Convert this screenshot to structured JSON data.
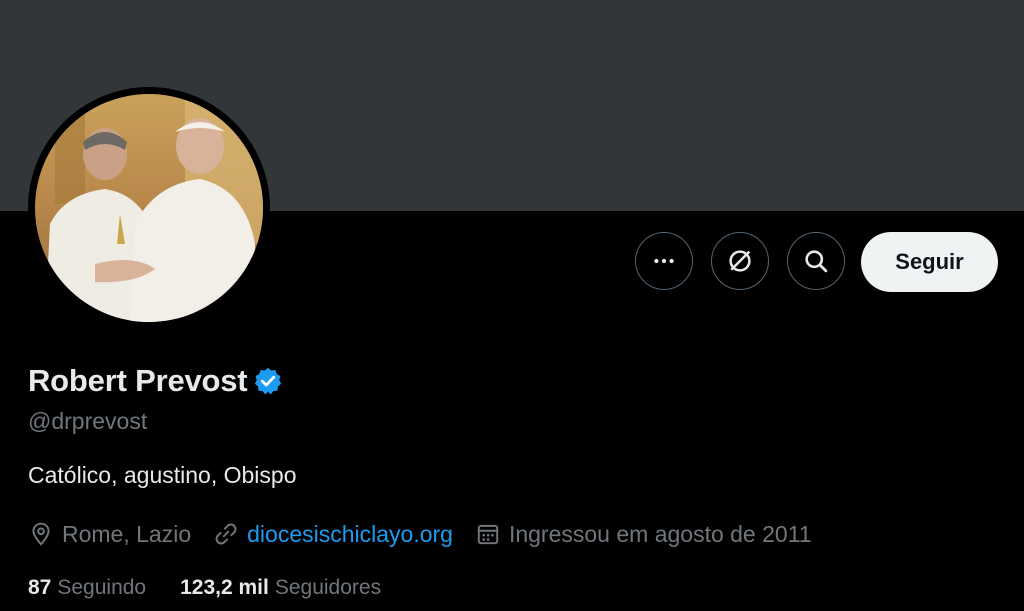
{
  "profile": {
    "display_name": "Robert Prevost",
    "handle": "@drprevost",
    "bio": "Católico, agustino, Obispo",
    "verified_icon": "verified-badge-icon",
    "avatar_alt": "avatar"
  },
  "actions": {
    "more_icon": "more-icon",
    "grok_icon": "grok-icon",
    "search_icon": "search-icon",
    "follow_label": "Seguir"
  },
  "meta": {
    "location": "Rome, Lazio",
    "website": "diocesischiclayo.org",
    "joined": "Ingressou em agosto de 2011",
    "location_icon": "location-pin-icon",
    "link_icon": "link-icon",
    "calendar_icon": "calendar-icon"
  },
  "stats": {
    "following_count": "87",
    "following_label": "Seguindo",
    "followers_count": "123,2 mil",
    "followers_label": "Seguidores"
  },
  "colors": {
    "banner": "#333639",
    "background": "#000000",
    "accent": "#1d9bf0",
    "text_primary": "#e7e9ea",
    "text_secondary": "#71767b",
    "follow_button": "#eff3f4"
  }
}
